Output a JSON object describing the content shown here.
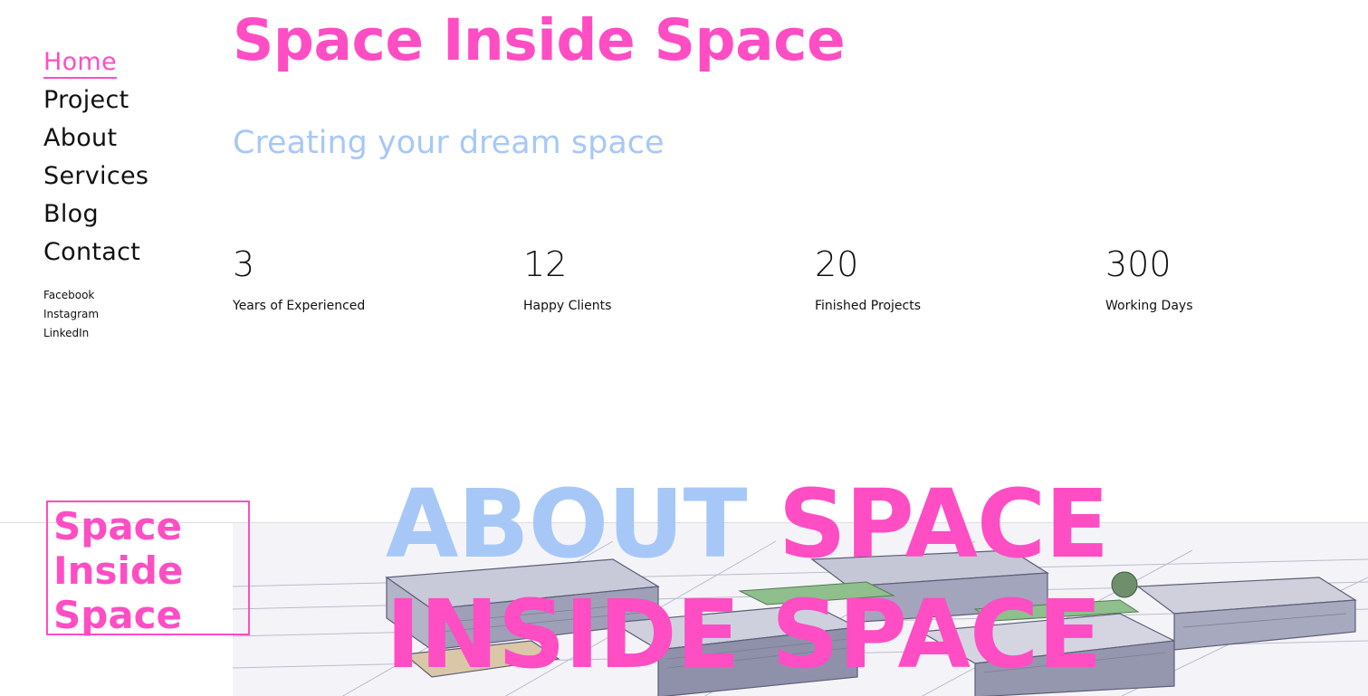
{
  "nav": {
    "items": [
      {
        "label": "Home",
        "active": true
      },
      {
        "label": "Project",
        "active": false
      },
      {
        "label": "About",
        "active": false
      },
      {
        "label": "Services",
        "active": false
      },
      {
        "label": "Blog",
        "active": false
      },
      {
        "label": "Contact",
        "active": false
      }
    ],
    "social": [
      "Facebook",
      "Instagram",
      "LinkedIn"
    ]
  },
  "hero": {
    "title": "Space Inside Space",
    "subtitle": "Creating your dream space"
  },
  "stats": [
    {
      "number": "3",
      "label": "Years of Experienced"
    },
    {
      "number": "12",
      "label": "Happy Clients"
    },
    {
      "number": "20",
      "label": "Finished Projects"
    },
    {
      "number": "300",
      "label": "Working Days"
    }
  ],
  "about": {
    "logo_lines": [
      "Space",
      "Inside",
      "Space"
    ],
    "heading_part_a": "ABOUT",
    "heading_part_b": "SPACE",
    "heading_line2": "INSIDE SPACE"
  },
  "colors": {
    "accent_pink": "#ff4dc4",
    "accent_blue": "#a7c8f7",
    "text": "#111111"
  }
}
